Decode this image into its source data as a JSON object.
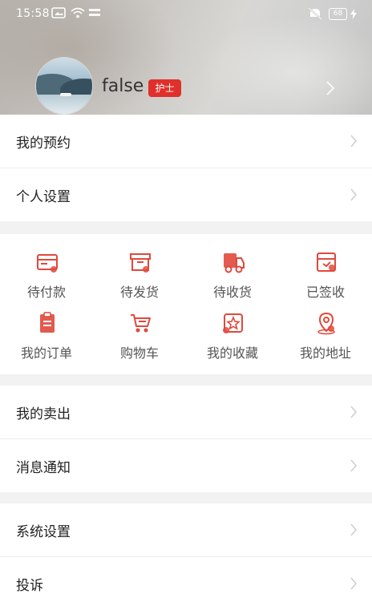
{
  "status_bar": {
    "time": "15:58",
    "battery": "68"
  },
  "profile": {
    "name": "false",
    "role_badge": "护士"
  },
  "menu_group_1": [
    {
      "label": "我的预约"
    },
    {
      "label": "个人设置"
    }
  ],
  "orders": [
    {
      "label": "待付款",
      "icon": "wallet-icon"
    },
    {
      "label": "待发货",
      "icon": "box-icon"
    },
    {
      "label": "待收货",
      "icon": "truck-icon"
    },
    {
      "label": "已签收",
      "icon": "signed-box-icon"
    },
    {
      "label": "我的订单",
      "icon": "clipboard-icon"
    },
    {
      "label": "购物车",
      "icon": "cart-icon"
    },
    {
      "label": "我的收藏",
      "icon": "star-icon"
    },
    {
      "label": "我的地址",
      "icon": "location-pin-icon"
    }
  ],
  "menu_group_2": [
    {
      "label": "我的卖出"
    },
    {
      "label": "消息通知"
    }
  ],
  "menu_group_3": [
    {
      "label": "系统设置"
    },
    {
      "label": "投诉"
    }
  ],
  "colors": {
    "accent": "#e0302b",
    "icon_red": "#e0493c"
  }
}
